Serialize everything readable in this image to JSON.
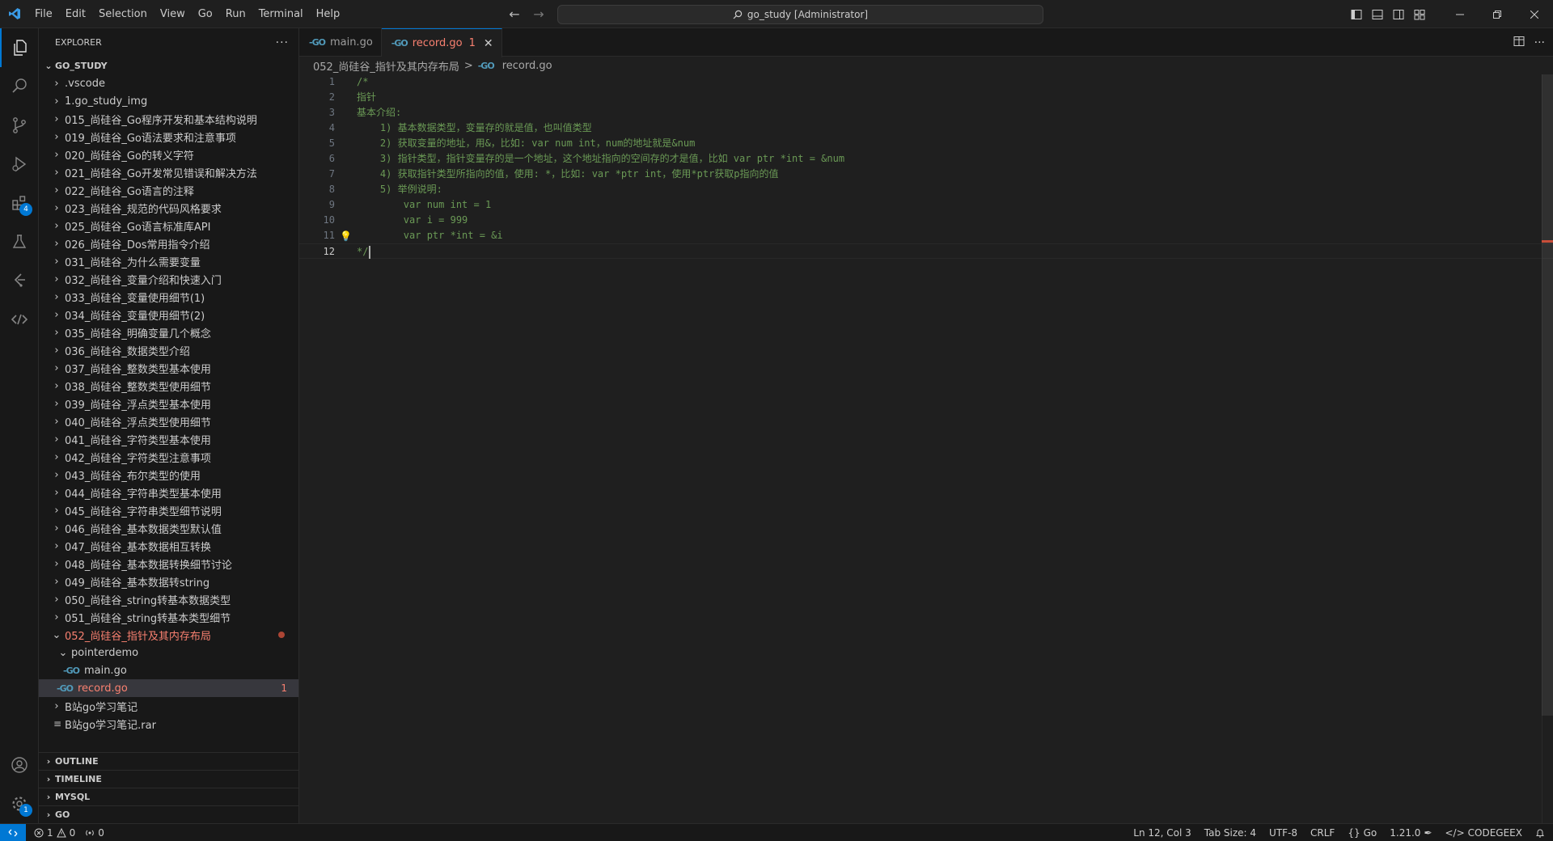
{
  "menu": [
    "File",
    "Edit",
    "Selection",
    "View",
    "Go",
    "Run",
    "Terminal",
    "Help"
  ],
  "command_center": {
    "text": "go_study [Administrator]"
  },
  "activity": {
    "extensions_badge": "4",
    "settings_badge": "1"
  },
  "explorer": {
    "title": "EXPLORER",
    "root": "GO_STUDY",
    "folders": [
      ".vscode",
      "1.go_study_img",
      "015_尚硅谷_Go程序开发和基本结构说明",
      "019_尚硅谷_Go语法要求和注意事项",
      "020_尚硅谷_Go的转义字符",
      "021_尚硅谷_Go开发常见错误和解决方法",
      "022_尚硅谷_Go语言的注释",
      "023_尚硅谷_规范的代码风格要求",
      "025_尚硅谷_Go语言标准库API",
      "026_尚硅谷_Dos常用指令介绍",
      "031_尚硅谷_为什么需要变量",
      "032_尚硅谷_变量介绍和快速入门",
      "033_尚硅谷_变量使用细节(1)",
      "034_尚硅谷_变量使用细节(2)",
      "035_尚硅谷_明确变量几个概念",
      "036_尚硅谷_数据类型介绍",
      "037_尚硅谷_整数类型基本使用",
      "038_尚硅谷_整数类型使用细节",
      "039_尚硅谷_浮点类型基本使用",
      "040_尚硅谷_浮点类型使用细节",
      "041_尚硅谷_字符类型基本使用",
      "042_尚硅谷_字符类型注意事项",
      "043_尚硅谷_布尔类型的使用",
      "044_尚硅谷_字符串类型基本使用",
      "045_尚硅谷_字符串类型细节说明",
      "046_尚硅谷_基本数据类型默认值",
      "047_尚硅谷_基本数据相互转换",
      "048_尚硅谷_基本数据转换细节讨论",
      "049_尚硅谷_基本数据转string",
      "050_尚硅谷_string转基本数据类型",
      "051_尚硅谷_string转基本类型细节"
    ],
    "open_folder": "052_尚硅谷_指针及其内存布局",
    "subfolder": "pointerdemo",
    "sub_file": "main.go",
    "selected_file": "record.go",
    "selected_file_count": "1",
    "after_folder": "B站go学习笔记",
    "after_file": "B站go学习笔记.rar",
    "sections": [
      "OUTLINE",
      "TIMELINE",
      "MYSQL",
      "GO"
    ]
  },
  "tabs": [
    {
      "label": "main.go"
    },
    {
      "label": "record.go",
      "count": "1"
    }
  ],
  "breadcrumb": {
    "folder": "052_尚硅谷_指针及其内存布局",
    "file": "record.go",
    "sep": ">"
  },
  "code": [
    {
      "n": "1",
      "text": "/*"
    },
    {
      "n": "2",
      "text": "指针"
    },
    {
      "n": "3",
      "text": "基本介绍:"
    },
    {
      "n": "4",
      "text": "    1) 基本数据类型，变量存的就是值，也叫值类型"
    },
    {
      "n": "5",
      "text": "    2) 获取变量的地址，用&，比如: var num int，num的地址就是&num"
    },
    {
      "n": "6",
      "text": "    3) 指针类型，指针变量存的是一个地址，这个地址指向的空间存的才是值，比如 var ptr *int = &num"
    },
    {
      "n": "7",
      "text": "    4) 获取指针类型所指向的值，使用: *，比如: var *ptr int，使用*ptr获取p指向的值"
    },
    {
      "n": "8",
      "text": "    5) 举例说明:"
    },
    {
      "n": "9",
      "text": "        var num int = 1"
    },
    {
      "n": "10",
      "text": "        var i = 999"
    },
    {
      "n": "11",
      "text": "        var ptr *int = &i"
    },
    {
      "n": "12",
      "text": "*/"
    }
  ],
  "status": {
    "errors": "1",
    "warnings": "0",
    "ports": "0",
    "position": "Ln 12, Col 3",
    "tab_size": "Tab Size: 4",
    "encoding": "UTF-8",
    "eol": "CRLF",
    "language": "Go",
    "go_version": "1.21.0",
    "codegeex": "CODEGEEX"
  },
  "colors": {
    "accent": "#0078d4",
    "error": "#f88070",
    "comment": "#6a9955"
  }
}
